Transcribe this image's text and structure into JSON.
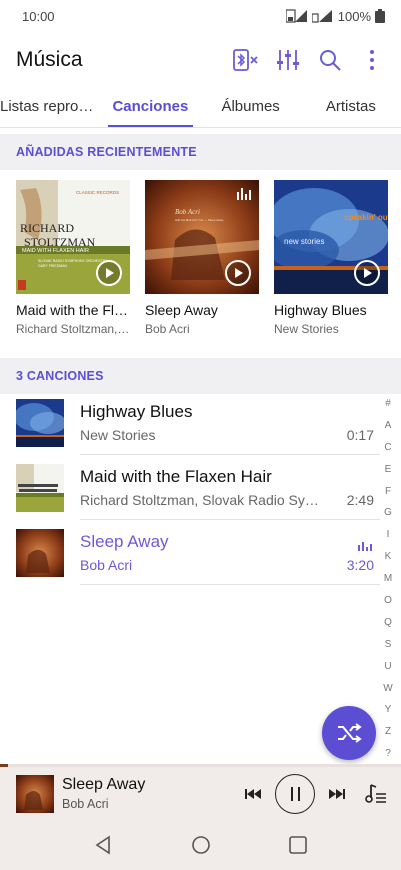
{
  "status": {
    "time": "10:00",
    "battery": "100%"
  },
  "app": {
    "title": "Música"
  },
  "icons": {
    "bluetooth_off": "bluetooth-off-icon",
    "equalizer": "equalizer-icon",
    "search": "search-icon",
    "more": "more-vert-icon"
  },
  "tabs": [
    {
      "label": "Listas reprod…",
      "active": false
    },
    {
      "label": "Canciones",
      "active": true
    },
    {
      "label": "Álbumes",
      "active": false
    },
    {
      "label": "Artistas",
      "active": false
    }
  ],
  "recent": {
    "header": "AÑADIDAS RECIENTEMENTE",
    "items": [
      {
        "title": "Maid with the Fl…",
        "artist": "Richard Stoltzman, …",
        "cover_text": {
          "top": "CLASSIC RECORDS",
          "name1": "RICHARD",
          "name2": "STOLTZMAN",
          "album": "MAID WITH FLAXEN HAIR",
          "band1": "SLOVAK RADIO SYMPHONY ORCHESTRA",
          "band2": "GARY FRIEDMAN"
        }
      },
      {
        "title": "Sleep Away",
        "artist": "Bob Acri",
        "cover_text": {
          "name": "Bob Acri",
          "line": "with the Bob Acri Trio — Sleep Away"
        }
      },
      {
        "title": "Highway Blues",
        "artist": "New Stories",
        "cover_text": {
          "name": "new stories",
          "top": "speakin' out"
        }
      }
    ]
  },
  "songs": {
    "header": "3 CANCIONES",
    "items": [
      {
        "title": "Highway Blues",
        "artist": "New Stories",
        "duration": "0:17",
        "playing": false
      },
      {
        "title": "Maid with the Flaxen Hair",
        "artist": "Richard Stoltzman, Slovak Radio Symp…",
        "duration": "2:49",
        "playing": false
      },
      {
        "title": "Sleep Away",
        "artist": "Bob Acri",
        "duration": "3:20",
        "playing": true
      }
    ]
  },
  "alpha_index": [
    "#",
    "A",
    "C",
    "E",
    "F",
    "G",
    "I",
    "K",
    "M",
    "O",
    "Q",
    "S",
    "U",
    "W",
    "Y",
    "Z",
    "?"
  ],
  "mini_player": {
    "title": "Sleep Away",
    "artist": "Bob Acri",
    "progress": 0.02
  },
  "colors": {
    "accent": "#5c4ed3",
    "accent_light": "#6b5bd6",
    "player_bg": "#f1ecea"
  }
}
